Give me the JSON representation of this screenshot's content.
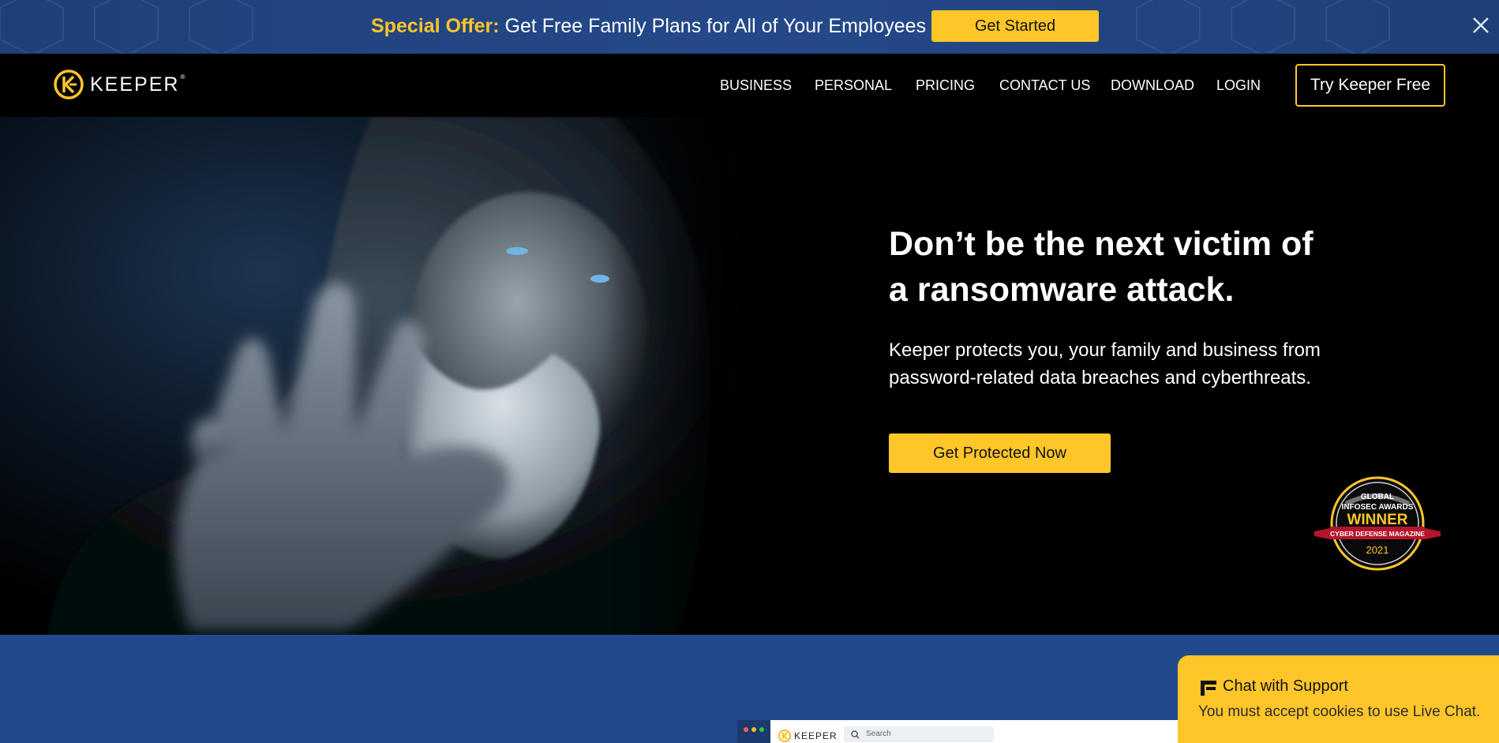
{
  "promo": {
    "highlight": "Special Offer:",
    "text": " Get Free Family Plans for All of Your Employees",
    "button_label": "Get Started",
    "close_icon": "close-icon"
  },
  "header": {
    "logo_text": "KEEPER",
    "logo_tm": "®",
    "nav": {
      "business": "BUSINESS",
      "personal": "PERSONAL",
      "pricing": "PRICING",
      "contact": "CONTACT US",
      "download": "DOWNLOAD",
      "login": "LOGIN"
    },
    "try_button": "Try Keeper Free"
  },
  "hero": {
    "title_line1": "Don’t be the next victim of",
    "title_line2": "a ransomware attack.",
    "subtitle_line1": "Keeper protects you, your family and business from",
    "subtitle_line2": "password-related data breaches and cyberthreats.",
    "cta_label": "Get Protected Now",
    "award": {
      "line1": "GLOBAL",
      "line2": "INFOSEC AWARDS",
      "line3": "WINNER",
      "line4": "CYBER DEFENSE MAGAZINE",
      "year": "2021"
    }
  },
  "app_preview": {
    "logo_text": "KEEPER",
    "search_placeholder": "Search"
  },
  "chat": {
    "title": "Chat with Support",
    "message": "You must accept cookies to use Live Chat."
  },
  "colors": {
    "accent": "#ffc629",
    "banner_blue": "#24498a",
    "section_blue": "#214a8c",
    "background": "#000000"
  }
}
